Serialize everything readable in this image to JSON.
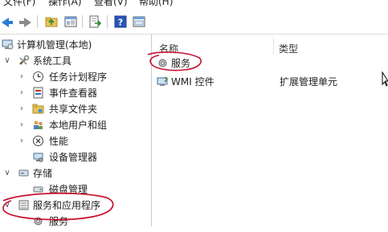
{
  "menu": {
    "file": "文件(F)",
    "action": "操作(A)",
    "view": "查看(V)",
    "help": "帮助(H)"
  },
  "tree": {
    "root": "计算机管理(本地)",
    "system_tools": "系统工具",
    "task_scheduler": "任务计划程序",
    "event_viewer": "事件查看器",
    "shared_folders": "共享文件夹",
    "local_users": "本地用户和组",
    "performance": "性能",
    "device_manager": "设备管理器",
    "storage": "存储",
    "disk_management": "磁盘管理",
    "services_apps": "服务和应用程序",
    "services": "服务"
  },
  "list": {
    "columns": {
      "name": "名称",
      "type": "类型"
    },
    "rows": [
      {
        "name": "服务",
        "type": ""
      },
      {
        "name": "WMI 控件",
        "type": "扩展管理单元"
      }
    ]
  },
  "colors": {
    "annotation_red": "#c8102e",
    "toolbar_blue": "#2b7bd6"
  },
  "icons": [
    "back-arrow-icon",
    "forward-arrow-icon",
    "folder-up-icon",
    "show-hide-tree-icon",
    "export-list-icon",
    "help-icon",
    "properties-icon"
  ]
}
